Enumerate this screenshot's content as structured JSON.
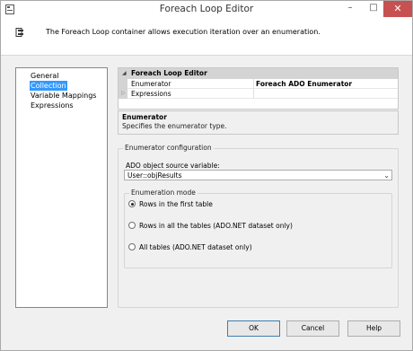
{
  "window": {
    "title": "Foreach Loop Editor",
    "controls": {
      "minimize": "–",
      "maximize": "□",
      "close": "✕"
    }
  },
  "header": {
    "description": "The Foreach Loop container allows execution iteration over an enumeration."
  },
  "nav": {
    "items": [
      {
        "label": "General",
        "selected": false
      },
      {
        "label": "Collection",
        "selected": true
      },
      {
        "label": "Variable Mappings",
        "selected": false
      },
      {
        "label": "Expressions",
        "selected": false
      }
    ]
  },
  "property_grid": {
    "category": "Foreach Loop Editor",
    "rows": [
      {
        "name": "Enumerator",
        "value": "Foreach ADO Enumerator"
      },
      {
        "name": "Expressions",
        "value": ""
      }
    ]
  },
  "help": {
    "title": "Enumerator",
    "description": "Specifies the enumerator type."
  },
  "enumerator_config": {
    "legend": "Enumerator configuration",
    "source_label": "ADO object source variable:",
    "source_value": "User::objResults",
    "mode": {
      "legend": "Enumeration mode",
      "options": [
        {
          "label": "Rows in the first table",
          "checked": true
        },
        {
          "label": "Rows in all the tables (ADO.NET dataset only)",
          "checked": false
        },
        {
          "label": "All tables (ADO.NET dataset only)",
          "checked": false
        }
      ]
    }
  },
  "buttons": {
    "ok": "OK",
    "cancel": "Cancel",
    "help": "Help"
  },
  "icons": {
    "window": "package-icon",
    "header": "foreach-loop-icon",
    "expand": "triangle-down-icon",
    "collapsed": "triangle-right-icon",
    "dropdown": "chevron-down-icon"
  },
  "colors": {
    "selection": "#3399ff",
    "close_button": "#c75050",
    "panel": "#f0f0f0"
  }
}
